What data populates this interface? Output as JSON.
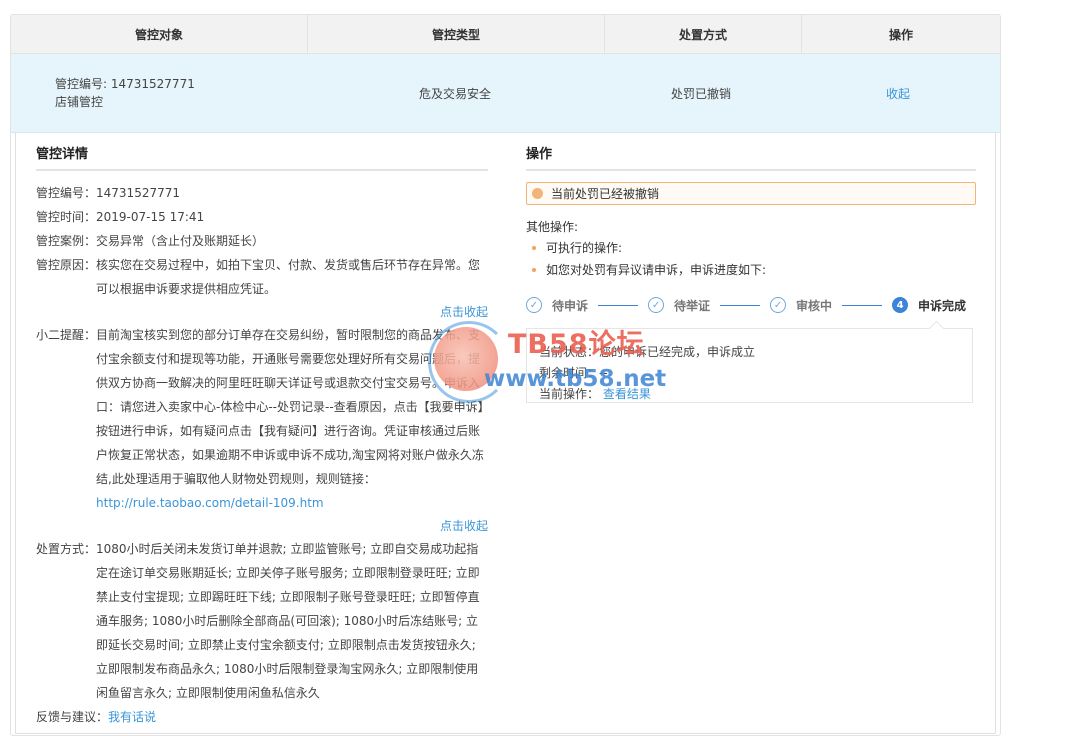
{
  "table": {
    "headers": [
      "管控对象",
      "管控类型",
      "处置方式",
      "操作"
    ],
    "row": {
      "object_id": "管控编号: 14731527771",
      "object_scope": "店铺管控",
      "type": "危及交易安全",
      "disposal": "处罚已撤销",
      "action": "收起"
    }
  },
  "detail": {
    "title": "管控详情",
    "id_label": "管控编号：",
    "id_value": "14731527771",
    "time_label": "管控时间：",
    "time_value": "2019-07-15 17:41",
    "case_label": "管控案例：",
    "case_value": "交易异常（含止付及账期延长）",
    "reason_label": "管控原因：",
    "reason_value": "核实您在交易过程中，如拍下宝贝、付款、发货或售后环节存在异常。您可以根据申诉要求提供相应凭证。",
    "collapse1": "点击收起",
    "tip_label": "小二提醒：",
    "tip_value": "目前淘宝核实到您的部分订单存在交易纠纷，暂时限制您的商品发布、支付宝余额支付和提现等功能，开通账号需要您处理好所有交易问题后，提供双方协商一致解决的阿里旺旺聊天详证号或退款交付宝交易号。申诉入口：请您进入卖家中心-体检中心--处罚记录--查看原因，点击【我要申诉】按钮进行申诉，如有疑问点击【我有疑问】进行咨询。凭证审核通过后账户恢复正常状态，如果逾期不申诉或申诉不成功,淘宝网将对账户做永久冻结,此处理适用于骗取他人财物处罚规则，规则链接：",
    "tip_link": "http://rule.taobao.com/detail-109.htm",
    "collapse2": "点击收起",
    "measure_label": "处置方式：",
    "measure_value": "1080小时后关闭未发货订单并退款; 立即监管账号; 立即自交易成功起指定在途订单交易账期延长; 立即关停子账号服务; 立即限制登录旺旺; 立即禁止支付宝提现; 立即踢旺旺下线; 立即限制子账号登录旺旺; 立即暂停直通车服务; 1080小时后删除全部商品(可回滚); 1080小时后冻结账号; 立即延长交易时间; 立即禁止支付宝余额支付; 立即限制点击发货按钮永久; 立即限制发布商品永久; 1080小时后限制登录淘宝网永久; 立即限制使用闲鱼留言永久; 立即限制使用闲鱼私信永久",
    "feedback_label": "反馈与建议：",
    "feedback_link": "我有话说"
  },
  "operation": {
    "title": "操作",
    "status": "当前处罚已经被撤销",
    "other_label": "其他操作:",
    "bullets": [
      "可执行的操作:",
      "如您对处罚有异议请申诉，申诉进度如下:"
    ],
    "steps": [
      {
        "label": "待申诉",
        "state": "done"
      },
      {
        "label": "待举证",
        "state": "done"
      },
      {
        "label": "审核中",
        "state": "done"
      },
      {
        "label": "申诉完成",
        "state": "current",
        "num": "4"
      }
    ],
    "result_status": "当前状态：您的申诉已经完成，申诉成立",
    "result_time": "剩余时间：--",
    "result_op_label": "当前操作：",
    "result_op_link": "查看结果"
  },
  "watermark": {
    "line1": "TB58论坛",
    "line2": "www.tb58.net"
  }
}
